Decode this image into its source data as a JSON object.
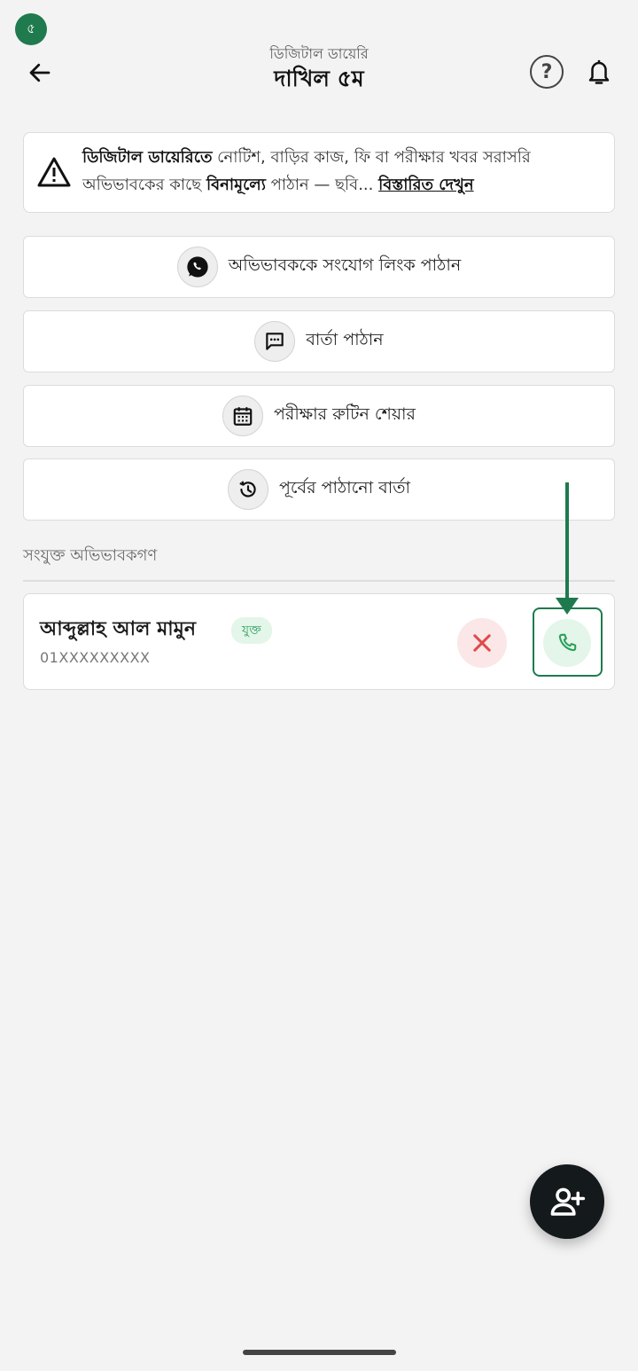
{
  "status": {
    "badge": "৫"
  },
  "header": {
    "subtitle": "ডিজিটাল ডায়েরি",
    "title": "দাখিল ৫ম",
    "help_symbol": "?"
  },
  "notice": {
    "bold_lead": "ডিজিটাল ডায়েরিতে",
    "text_1": " নোটিশ, বাড়ির কাজ, ফি বা পরীক্ষার খবর সরাসরি অভিভাবকের কাছে ",
    "bold_mid": "বিনামূল্যে",
    "text_2": " পাঠান — ছবি... ",
    "more_link": "বিস্তারিত দেখুন"
  },
  "actions": [
    {
      "label": "অভিভাবককে সংযোগ লিংক পাঠান",
      "icon": "whatsapp-icon"
    },
    {
      "label": "বার্তা পাঠান",
      "icon": "message-icon"
    },
    {
      "label": "পরীক্ষার রুটিন শেয়ার",
      "icon": "calendar-icon"
    },
    {
      "label": "পূর্বের পাঠানো বার্তা",
      "icon": "history-icon"
    }
  ],
  "guardians": {
    "section_label": "সংযুক্ত অভিভাবকগণ",
    "items": [
      {
        "name": "আব্দুল্লাহ আল মামুন",
        "status": "যুক্ত",
        "phone": "01XXXXXXXXX"
      }
    ]
  },
  "colors": {
    "brand_green": "#1e7a4e",
    "success_green": "#29a05a",
    "danger_red": "#e04a4a",
    "fab_dark": "#14191c"
  }
}
